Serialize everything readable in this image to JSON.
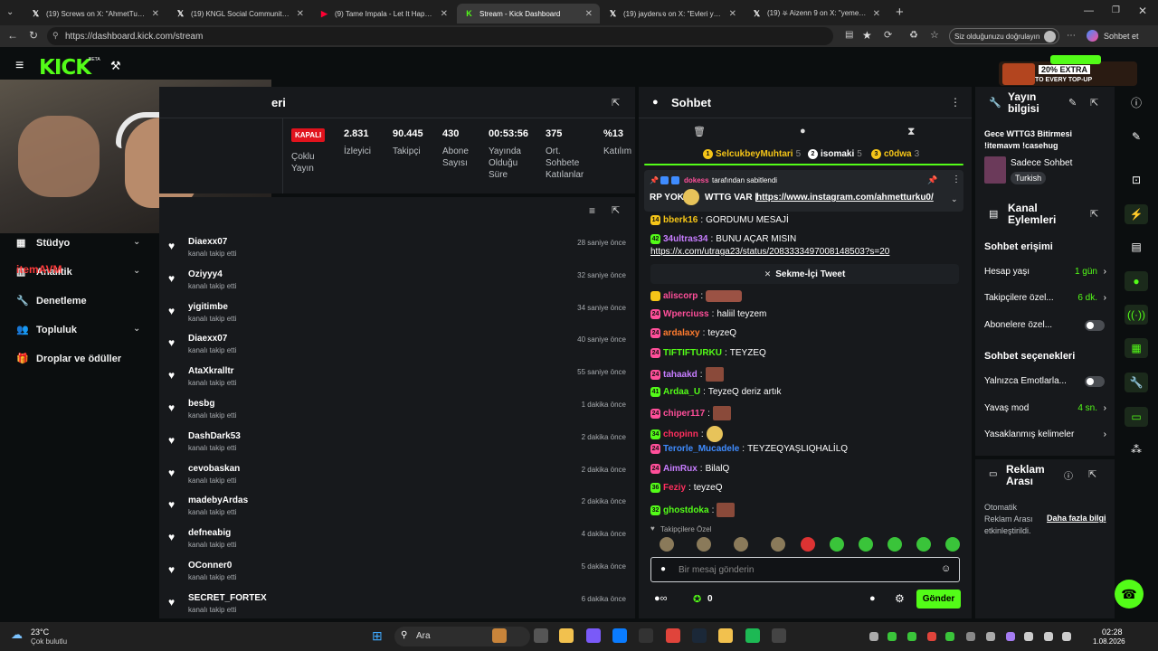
{
  "browser": {
    "tabs": [
      {
        "icon": "x-logo-icon",
        "label": "(19) Screws on X: \"AhmetTurku Bu",
        "color": "#fff"
      },
      {
        "icon": "x-logo-icon",
        "label": "(19) KNGL Social Community / X",
        "color": "#fff"
      },
      {
        "icon": "youtube-icon",
        "label": "(9) Tame Impala - Let It Happen (O",
        "color": "#ff0033"
      },
      {
        "icon": "kick-icon",
        "label": "Stream - Kick Dashboard",
        "color": "#53fc18"
      },
      {
        "icon": "x-logo-icon",
        "label": "(19) jaydenเจ on X: \"Evleri yakın ol",
        "color": "#fff"
      },
      {
        "icon": "x-logo-icon",
        "label": "(19) ⛧ Aizenn 9 on X: \"yemek yap",
        "color": "#fff"
      }
    ],
    "url": "https://dashboard.kick.com/stream",
    "verify_pill": "Siz olduğunuzu doğrulayın",
    "profile_label": "Sohbet et"
  },
  "app": {
    "logo": "KICK",
    "beta": "BETA",
    "promo_top": "20% EXTRA",
    "promo_bottom": "TO EVERY TOP-UP"
  },
  "sidebar": {
    "items": [
      {
        "label": "Stüdyo",
        "icon": "studio-icon",
        "chevron": true
      },
      {
        "label": "Analitik",
        "icon": "analytics-icon",
        "chevron": true
      },
      {
        "label": "Denetleme",
        "icon": "wrench-icon",
        "chevron": false
      },
      {
        "label": "Topluluk",
        "icon": "community-icon",
        "chevron": true
      },
      {
        "label": "Droplar ve ödüller",
        "icon": "gift-icon",
        "chevron": false
      }
    ],
    "overlay_text": "itemAVM"
  },
  "stats": {
    "title_fragment": "eri",
    "status_badge": "KAPALI",
    "multi_stream": "Çoklu Yayın",
    "items": [
      {
        "value": "2.831",
        "label": "İzleyici"
      },
      {
        "value": "90.445",
        "label": "Takipçi"
      },
      {
        "value": "430",
        "label": "Abone Sayısı"
      },
      {
        "value": "00:53:56",
        "label": "Yayında Olduğu Süre"
      },
      {
        "value": "375",
        "label": "Ort. Sohbete Katılanlar"
      },
      {
        "value": "%13",
        "label": "Katılım"
      }
    ]
  },
  "followers": [
    {
      "name": "Diaexx07",
      "sub": "kanalı takip etti",
      "time": "28 saniye önce"
    },
    {
      "name": "Oziyyy4",
      "sub": "kanalı takip etti",
      "time": "32 saniye önce"
    },
    {
      "name": "yigitimbe",
      "sub": "kanalı takip etti",
      "time": "34 saniye önce"
    },
    {
      "name": "Diaexx07",
      "sub": "kanalı takip etti",
      "time": "40 saniye önce"
    },
    {
      "name": "AtaXkralltr",
      "sub": "kanalı takip etti",
      "time": "55 saniye önce"
    },
    {
      "name": "besbg",
      "sub": "kanalı takip etti",
      "time": "1 dakika önce"
    },
    {
      "name": "DashDark53",
      "sub": "kanalı takip etti",
      "time": "2 dakika önce"
    },
    {
      "name": "cevobaskan",
      "sub": "kanalı takip etti",
      "time": "2 dakika önce"
    },
    {
      "name": "madebyArdas",
      "sub": "kanalı takip etti",
      "time": "2 dakika önce"
    },
    {
      "name": "defneabig",
      "sub": "kanalı takip etti",
      "time": "4 dakika önce"
    },
    {
      "name": "OConner0",
      "sub": "kanalı takip etti",
      "time": "5 dakika önce"
    },
    {
      "name": "SECRET_FORTEX",
      "sub": "kanalı takip etti",
      "time": "6 dakika önce"
    }
  ],
  "chat": {
    "title": "Sohbet",
    "leaders": [
      {
        "rank": "1",
        "name": "SelcukbeyMuhtari",
        "count": "5",
        "color": "#f5c518"
      },
      {
        "rank": "2",
        "name": "isomaki",
        "count": "5",
        "color": "#ffffff"
      },
      {
        "rank": "3",
        "name": "c0dwa",
        "count": "3",
        "color": "#f5c518"
      }
    ],
    "pinned_by": "dokess",
    "pinned_suffix": "tarafından sabitlendi",
    "pinned_text_a": "RP YOK",
    "pinned_text_b": "WTTG VAR |",
    "pinned_link": "https://www.instagram.com/ahmetturku0/",
    "messages": [
      {
        "user": "bberk16",
        "color": "#f5c518",
        "text": "GORDUMU MESAJİ",
        "badge": "14",
        "bcolor": "#f5c518"
      },
      {
        "user": "34ultras34",
        "color": "#c77dff",
        "text": "BUNU AÇAR MISIN",
        "badge": "42",
        "bcolor": "#53fc18"
      },
      {
        "user": "aliscorp",
        "color": "#ff4f9a",
        "text": "",
        "badge": "",
        "bcolor": "#f5c518"
      },
      {
        "user": "Wperciuss",
        "color": "#ff4f9a",
        "text": "haliil teyzem",
        "badge": "24",
        "bcolor": "#ff4f9a"
      },
      {
        "user": "ardalaxy",
        "color": "#ff7b2e",
        "text": "teyzeQ",
        "badge": "24",
        "bcolor": "#ff4f9a"
      },
      {
        "user": "TIFTIFTURKU",
        "color": "#53fc18",
        "text": "TEYZEQ",
        "badge": "24",
        "bcolor": "#ff4f9a"
      },
      {
        "user": "tahaakd",
        "color": "#c77dff",
        "text": "",
        "badge": "24",
        "bcolor": "#ff4f9a"
      },
      {
        "user": "Ardaa_U",
        "color": "#53fc18",
        "text": "TeyzeQ deriz artık",
        "badge": "41",
        "bcolor": "#53fc18"
      },
      {
        "user": "chiper117",
        "color": "#ff4f9a",
        "text": "",
        "badge": "24",
        "bcolor": "#ff4f9a"
      },
      {
        "user": "chopinn",
        "color": "#ff2f5e",
        "text": "",
        "badge": "34",
        "bcolor": "#53fc18"
      },
      {
        "user": "Terorle_Mucadele",
        "color": "#3f8cff",
        "text": "TEYZEQYAŞLIQHALİLQ",
        "badge": "24",
        "bcolor": "#ff4f9a"
      },
      {
        "user": "AimRux",
        "color": "#c77dff",
        "text": "BilalQ",
        "badge": "24",
        "bcolor": "#ff4f9a"
      },
      {
        "user": "Feziy",
        "color": "#ff2f5e",
        "text": "teyzeQ",
        "badge": "36",
        "bcolor": "#53fc18"
      },
      {
        "user": "ghostdoka",
        "color": "#53fc18",
        "text": "",
        "badge": "32",
        "bcolor": "#53fc18"
      }
    ],
    "message_link": "https://x.com/utraga23/status/2083333497008148503?s=20",
    "tweet_label": "Sekme-İçi Tweet",
    "followers_only": "Takipçilere Özel",
    "input_placeholder": "Bir mesaj gönderin",
    "footer_count": "0",
    "send_label": "Gönder"
  },
  "stream_info": {
    "title": "Yayın bilgisi",
    "stream_title": "Gece WTTG3 Bitirmesi !itemavm !casehug",
    "category": "Sadece Sohbet",
    "language": "Turkish"
  },
  "channel_actions": {
    "title": "Kanal Eylemleri",
    "chat_access": "Sohbet erişimi",
    "account_age": "Hesap yaşı",
    "account_age_value": "1 gün",
    "followers_only": "Takipçilere özel...",
    "followers_only_value": "6 dk.",
    "subscribers_only": "Abonelere özel...",
    "chat_options": "Sohbet seçenekleri",
    "emotes_only": "Yalnızca Emotlarla...",
    "slow_mode": "Yavaş mod",
    "slow_mode_value": "4 sn.",
    "banned_words": "Yasaklanmış kelimeler"
  },
  "ad_break": {
    "title": "Reklam Arası",
    "auto_text": "Otomatik Reklam Arası etkinleştirildi.",
    "more_info": "Daha fazla bilgi"
  },
  "taskbar": {
    "weather_temp": "23°C",
    "weather_desc": "Çok bulutlu",
    "search_label": "Ara",
    "time": "02:28",
    "date": "1.08.2026"
  },
  "colors": {
    "kick_green": "#53fc18",
    "panel": "#17191c",
    "bg": "#0b0e0f"
  }
}
